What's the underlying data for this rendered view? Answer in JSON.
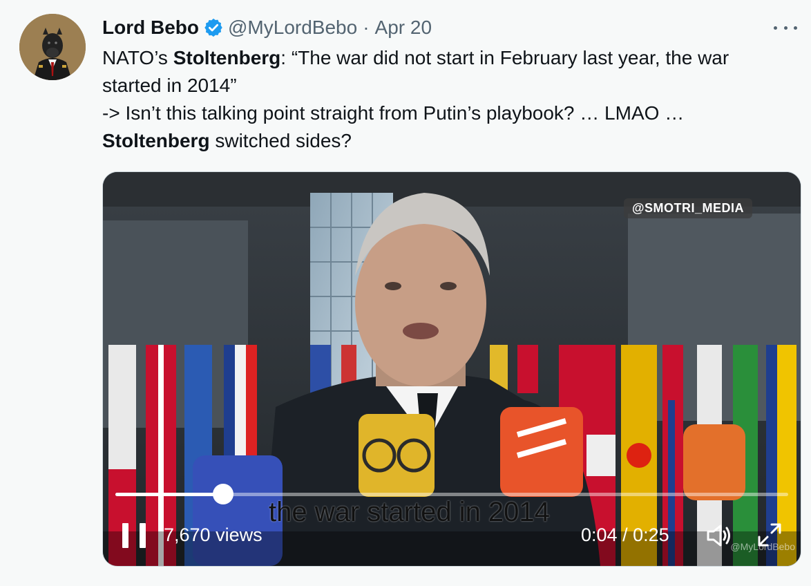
{
  "tweet": {
    "author_name": "Lord Bebo",
    "handle": "@MyLordBebo",
    "separator": "·",
    "date": "Apr 20",
    "text_lines": [
      {
        "pre": "NATO’s ",
        "bold": "Stoltenberg",
        "post": ": “The war did not start in February last year, the war"
      },
      {
        "pre": "started in 2014”",
        "bold": "",
        "post": ""
      },
      {
        "pre": "-> Isn’t this talking point straight from Putin’s playbook? … LMAO …",
        "bold": "",
        "post": ""
      },
      {
        "pre": "",
        "bold": "Stoltenberg",
        "post": " switched sides?"
      }
    ]
  },
  "icons": {
    "verified": "verified-badge-icon",
    "more": "more-options-icon",
    "pause": "pause-icon",
    "volume": "volume-icon",
    "fullscreen": "fullscreen-icon"
  },
  "video": {
    "overlay_watermark": "@SMOTRI_MEDIA",
    "caption": "the war started in 2014",
    "views": "7,670 views",
    "current_time": "0:04",
    "time_separator": " / ",
    "duration": "0:25",
    "progress_fraction": 0.16,
    "corner_watermark": "@MyLordBebo"
  },
  "colors": {
    "verified_blue": "#1d9bf0",
    "secondary_text": "#536471",
    "background": "#f7f9f9"
  }
}
